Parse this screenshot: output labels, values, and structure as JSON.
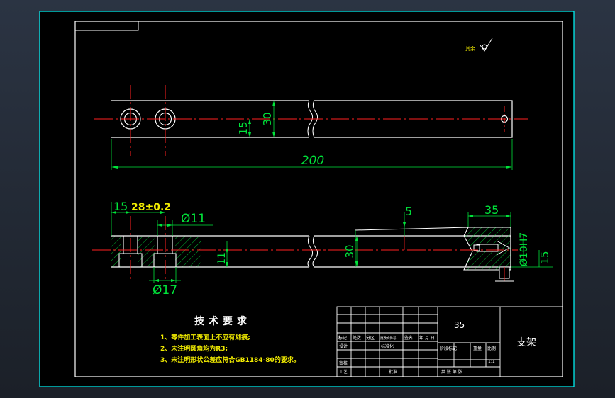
{
  "drawing": {
    "roughness_mark": "其余",
    "top_view": {
      "length_dim": "200",
      "height_dim": "30",
      "offset_dim": "15"
    },
    "front_view": {
      "dim_15": "15",
      "dim_28": "28±0.2",
      "dim_d11": "Ø11",
      "dim_d17": "Ø17",
      "dim_5": "5",
      "dim_35": "35",
      "dim_30": "30",
      "dim_11": "11",
      "dim_10h7": "Ø10H7",
      "dim_15b": "15"
    },
    "tech_req": {
      "title": "技术要求",
      "lines": [
        "1、零件加工表面上不应有划痕;",
        "2、未注明圆角均为R3;",
        "3、未注明形状公差应符合GB1184-80的要求。"
      ]
    },
    "title_block": {
      "material": "35",
      "part_name": "支架",
      "headers": [
        "标记",
        "处数",
        "分区",
        "更改文件号",
        "签名",
        "年 月 日"
      ],
      "designer": "设计",
      "standardize": "标准化",
      "checker": "审核",
      "process": "工艺",
      "approve": "批准",
      "stage_labels": "阶段标记",
      "weight": "重量",
      "scale": "比例",
      "scale_value": "1:1",
      "sheets": "共  张  第  张"
    }
  },
  "colors": {
    "outline": "#00ffff",
    "geometry": "#ffffff",
    "dimension": "#00e33a",
    "center": "#ff2020",
    "hatch": "#00e33a",
    "highlight": "#f2ec00"
  }
}
